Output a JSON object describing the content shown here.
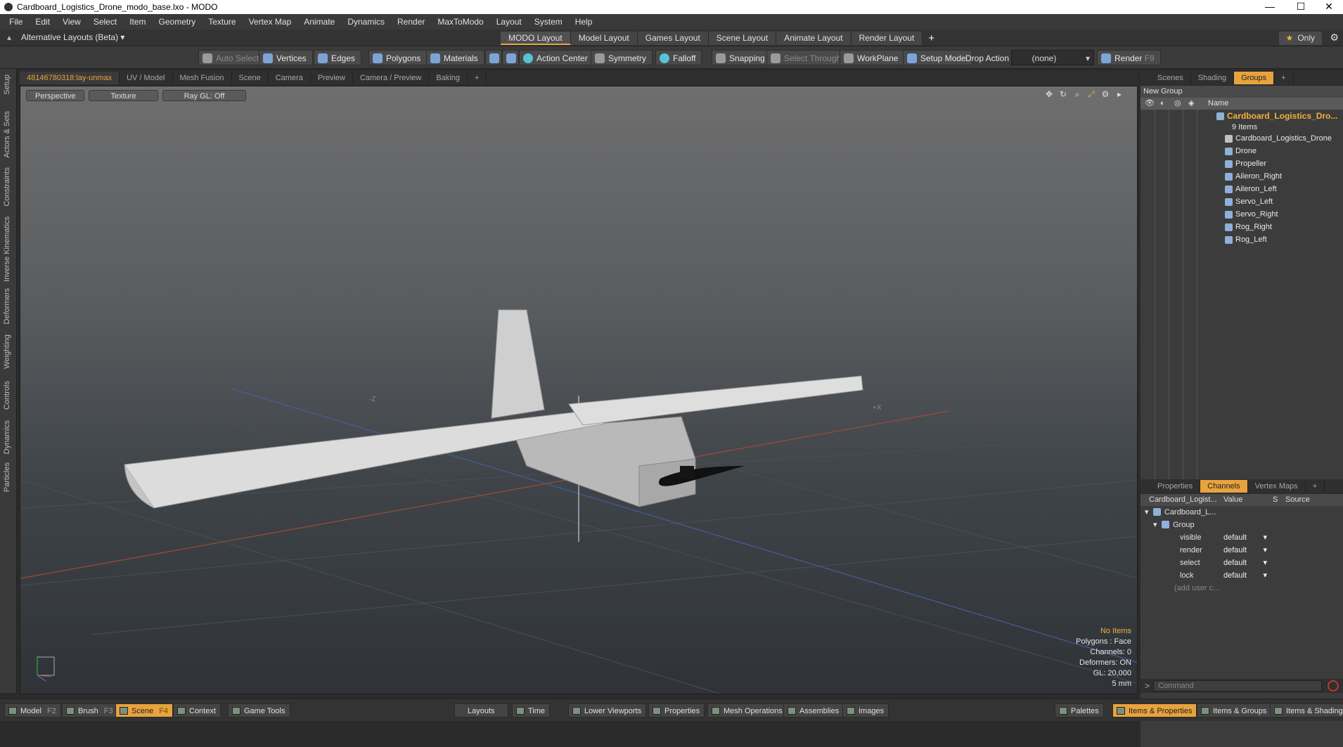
{
  "window": {
    "title": "Cardboard_Logistics_Drone_modo_base.lxo - MODO"
  },
  "menu": [
    "File",
    "Edit",
    "View",
    "Select",
    "Item",
    "Geometry",
    "Texture",
    "Vertex Map",
    "Animate",
    "Dynamics",
    "Render",
    "MaxToModo",
    "Layout",
    "System",
    "Help"
  ],
  "layout_bar": {
    "alt_layouts": "Alternative Layouts (Beta) ▾",
    "tabs": [
      "MODO Layout",
      "Model Layout",
      "Games Layout",
      "Scene Layout",
      "Animate Layout",
      "Render Layout"
    ],
    "active_tab": "MODO Layout",
    "only": "Only"
  },
  "toolbar": {
    "auto_select": "Auto Select",
    "vertices": "Vertices",
    "edges": "Edges",
    "polygons": "Polygons",
    "materials": "Materials",
    "action_center": "Action Center",
    "symmetry": "Symmetry",
    "falloff": "Falloff",
    "snapping": "Snapping",
    "select_through": "Select Through",
    "workplane": "WorkPlane",
    "setup_mode": "Setup Mode",
    "drop_action": "Drop Action",
    "drop_value": "(none)",
    "render": "Render",
    "render_key": "F9"
  },
  "left_strip": [
    "Setup",
    "Actors & Sets",
    "Constraints",
    "Inverse Kinematics",
    "Deformers",
    "Weighting",
    "Controls",
    "Dynamics",
    "Particles"
  ],
  "viewport_tabs": [
    "48146780318:lay-unmax",
    "UV / Model",
    "Mesh Fusion",
    "Scene",
    "Camera",
    "Preview",
    "Camera / Preview",
    "Baking",
    "+"
  ],
  "viewport": {
    "view": "Perspective",
    "shading": "Texture",
    "raygl": "Ray GL: Off",
    "axis_z": "-Z",
    "axis_x": "+X",
    "info": {
      "items": "No Items",
      "polygons": "Polygons : Face",
      "channels": "Channels: 0",
      "deformers": "Deformers: ON",
      "gl": "GL: 20,000",
      "scale": "5 mm"
    }
  },
  "groups_panel": {
    "tabs": [
      "Scenes",
      "Shading",
      "Groups"
    ],
    "active": "Groups",
    "new_group": "New Group",
    "name_header": "Name",
    "group_name": "Cardboard_Logistics_Dro...",
    "item_count": "9 Items",
    "items": [
      "Cardboard_Logistics_Drone",
      "Drone",
      "Propeller",
      "Aileron_Right",
      "Aileron_Left",
      "Servo_Left",
      "Servo_Right",
      "Rog_Right",
      "Rog_Left"
    ]
  },
  "channels_panel": {
    "tabs": [
      "Properties",
      "Channels",
      "Vertex Maps"
    ],
    "active": "Channels",
    "headers": [
      "Cardboard_Logist...",
      "Value",
      "S",
      "Source"
    ],
    "root": "Cardboard_L...",
    "group": "Group",
    "rows": [
      {
        "name": "visible",
        "value": "default"
      },
      {
        "name": "render",
        "value": "default"
      },
      {
        "name": "select",
        "value": "default"
      },
      {
        "name": "lock",
        "value": "default"
      }
    ],
    "add_user": "(add user c..."
  },
  "command": {
    "placeholder": "Command"
  },
  "statusbar": {
    "model": "Model",
    "model_key": "F2",
    "brush": "Brush",
    "brush_key": "F3",
    "scene": "Scene",
    "scene_key": "F4",
    "context": "Context",
    "game_tools": "Game Tools",
    "layouts": "Layouts",
    "time": "Time",
    "lower_viewports": "Lower Viewports",
    "properties": "Properties",
    "mesh_operations": "Mesh Operations",
    "assemblies": "Assemblies",
    "images": "Images",
    "palettes": "Palettes",
    "items_properties": "Items & Properties",
    "items_groups": "Items & Groups",
    "items_shading": "Items & Shading"
  }
}
